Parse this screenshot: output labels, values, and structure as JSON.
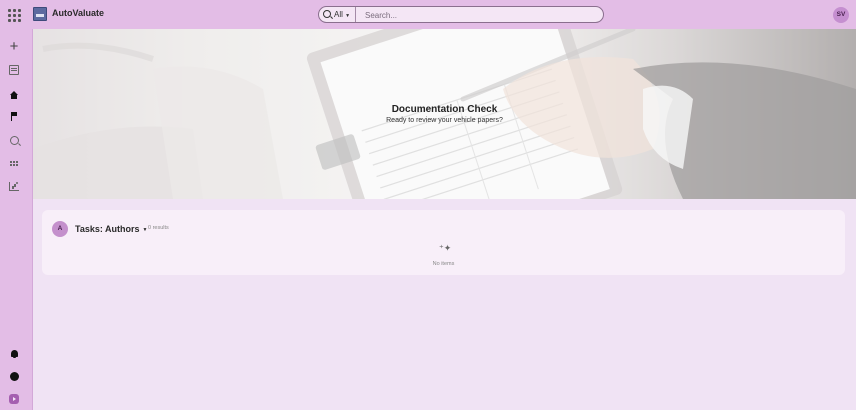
{
  "app": {
    "name": "AutoValuate"
  },
  "search": {
    "scope_label": "All",
    "placeholder": "Search..."
  },
  "user": {
    "initials": "SV"
  },
  "hero": {
    "title": "Documentation Check",
    "subtitle": "Ready to review your vehicle papers?"
  },
  "tasks": {
    "avatar_initial": "A",
    "title": "Tasks: Authors",
    "count_text": "0 results",
    "empty_text": "No items"
  },
  "colors": {
    "topbar": "#e3bde6",
    "background": "#f0e3f4",
    "card": "#f8eff9",
    "accent": "#c58fd0"
  }
}
